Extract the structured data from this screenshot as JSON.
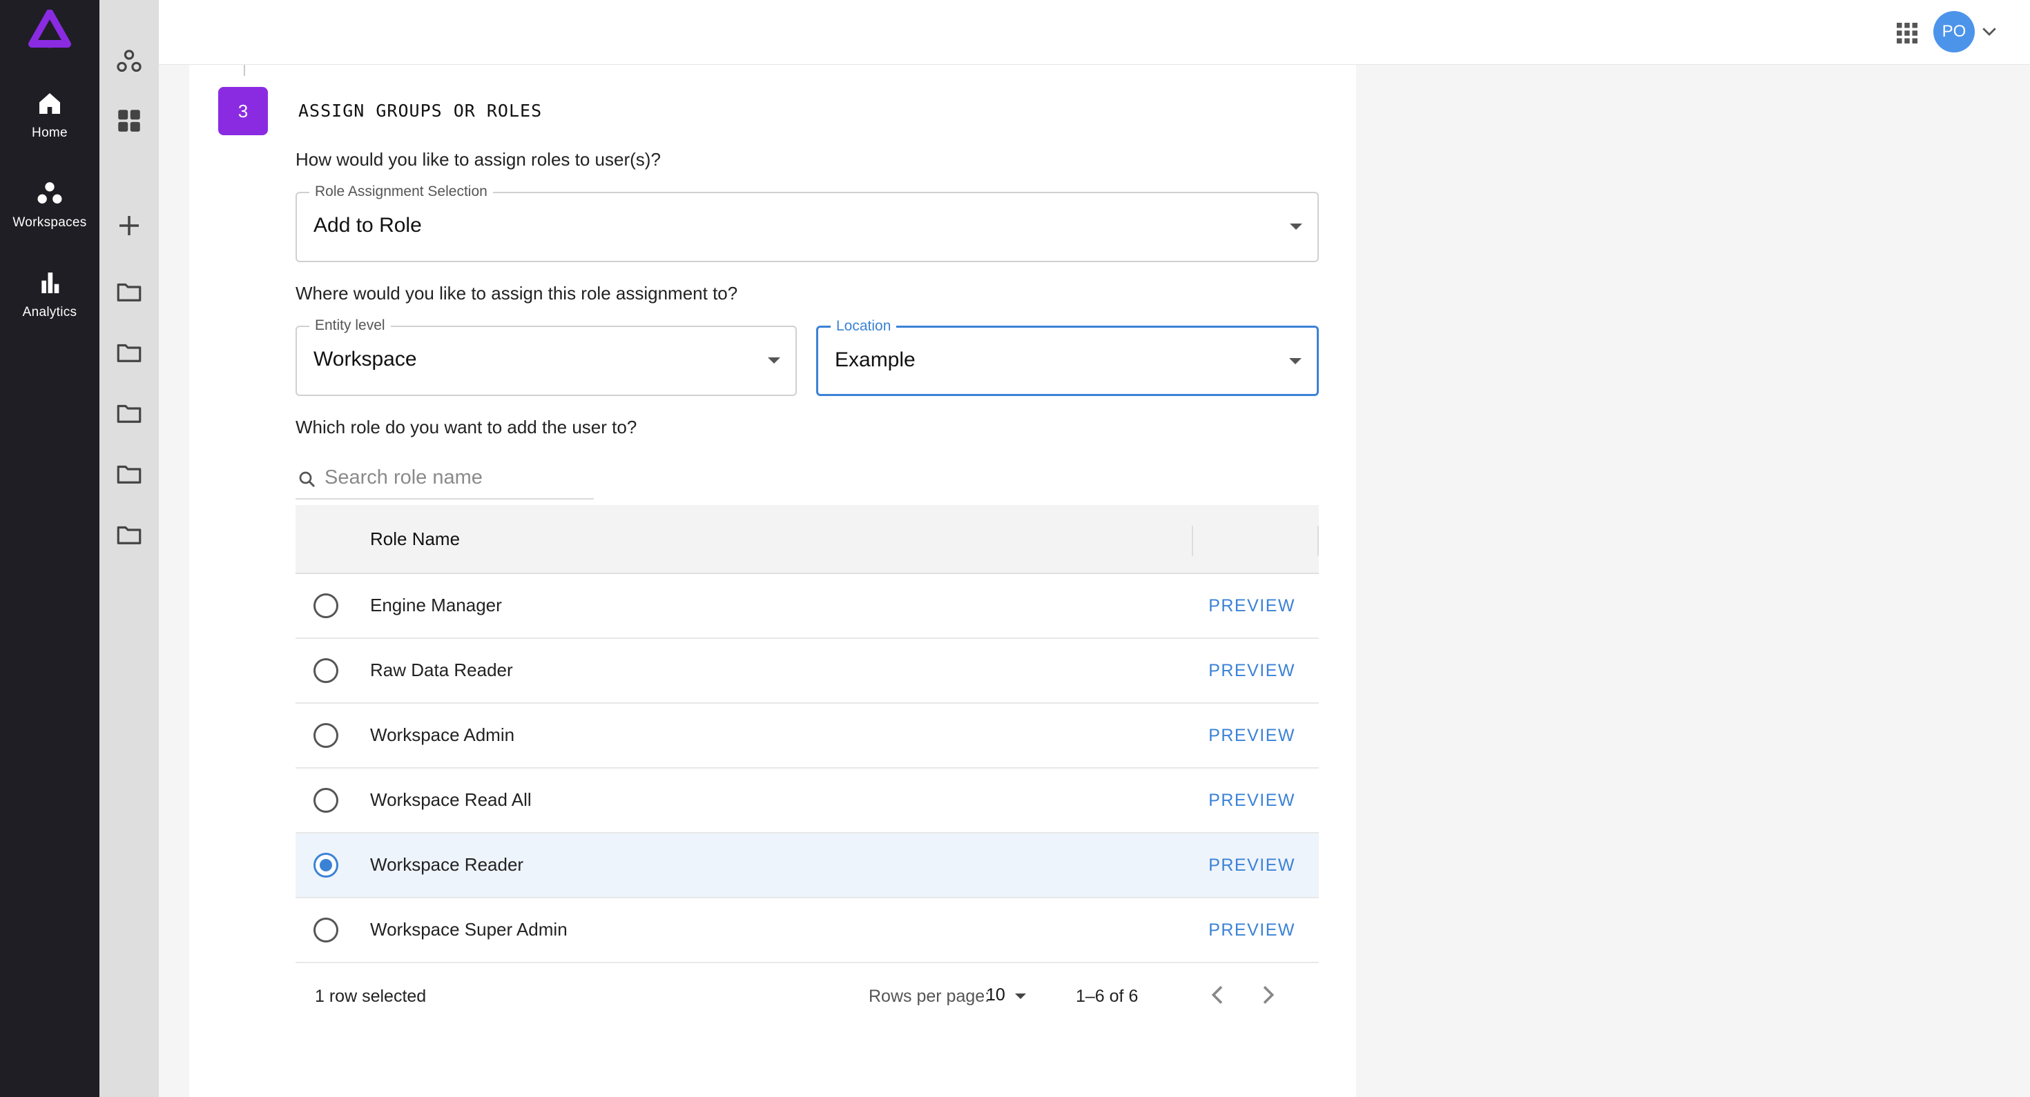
{
  "nav": {
    "items": [
      {
        "label": "Home",
        "icon": "home-icon"
      },
      {
        "label": "Workspaces",
        "icon": "workspaces-icon"
      },
      {
        "label": "Analytics",
        "icon": "analytics-icon"
      }
    ],
    "logo_color": "#8a2be2"
  },
  "topbar": {
    "avatar_initials": "PO",
    "avatar_color": "#4c94ea"
  },
  "step": {
    "number": "3",
    "title": "ASSIGN GROUPS OR ROLES",
    "accent": "#8a2be2"
  },
  "form": {
    "q1": "How would you like to assign roles to user(s)?",
    "role_assignment": {
      "label": "Role Assignment Selection",
      "value": "Add to Role"
    },
    "q2": "Where would you like to assign this role assignment to?",
    "entity_level": {
      "label": "Entity level",
      "value": "Workspace"
    },
    "location": {
      "label": "Location",
      "value": "Example"
    },
    "q3": "Which role do you want to add the user to?",
    "search_placeholder": "Search role name"
  },
  "table": {
    "column": "Role Name",
    "action_label": "PREVIEW",
    "rows": [
      {
        "name": "Engine Manager",
        "selected": false
      },
      {
        "name": "Raw Data Reader",
        "selected": false
      },
      {
        "name": "Workspace Admin",
        "selected": false
      },
      {
        "name": "Workspace Read All",
        "selected": false
      },
      {
        "name": "Workspace Reader",
        "selected": true
      },
      {
        "name": "Workspace Super Admin",
        "selected": false
      }
    ],
    "footer": {
      "selected_text": "1 row selected",
      "rows_per_page_label": "Rows per page:",
      "rows_per_page": "10",
      "range": "1–6 of 6"
    }
  },
  "colors": {
    "link": "#3b82d6"
  }
}
